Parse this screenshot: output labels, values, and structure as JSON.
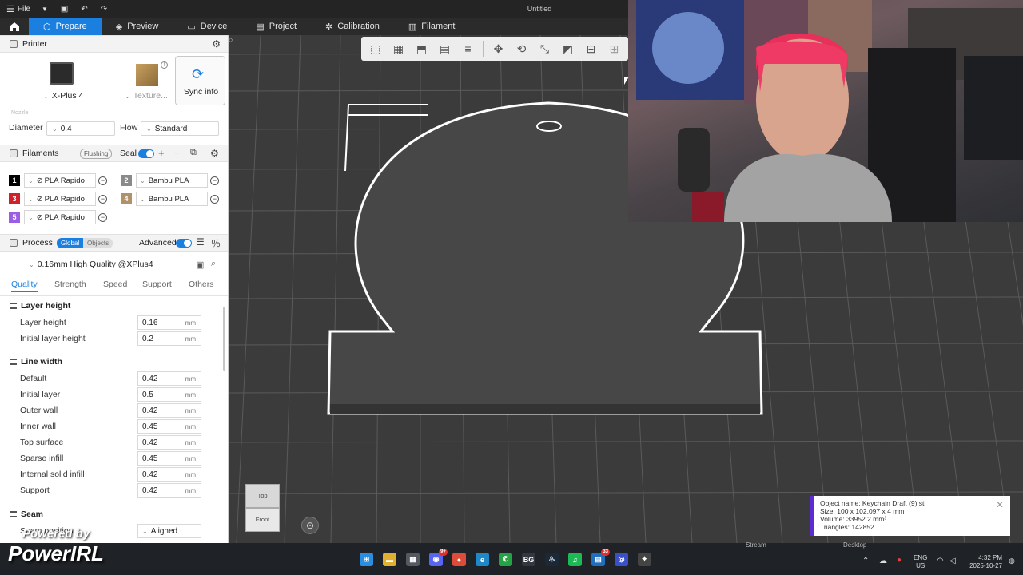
{
  "titlebar": {
    "file_label": "File",
    "title": "Untitled"
  },
  "tabs": [
    {
      "label": "Prepare",
      "icon": "cube-icon"
    },
    {
      "label": "Preview",
      "icon": "layers-icon"
    },
    {
      "label": "Device",
      "icon": "device-icon"
    },
    {
      "label": "Project",
      "icon": "project-icon"
    },
    {
      "label": "Calibration",
      "icon": "calibration-icon"
    },
    {
      "label": "Filament",
      "icon": "filament-icon"
    }
  ],
  "printer": {
    "section_title": "Printer",
    "model": "X-Plus 4",
    "plate": "Texture...",
    "sync_label": "Sync info",
    "nozzle_label": "Nozzle",
    "diameter_label": "Diameter",
    "diameter_value": "0.4",
    "flow_label": "Flow",
    "flow_value": "Standard"
  },
  "filaments": {
    "section_title": "Filaments",
    "flushing_label": "Flushing",
    "seal_label": "Seal",
    "items": [
      {
        "num": "1",
        "color": "#000000",
        "name": "PLA Rapido"
      },
      {
        "num": "2",
        "color": "#8a8a8a",
        "name": "Bambu PLA"
      },
      {
        "num": "3",
        "color": "#d0202a",
        "name": "PLA Rapido"
      },
      {
        "num": "4",
        "color": "#b0916a",
        "name": "Bambu PLA"
      },
      {
        "num": "5",
        "color": "#9b5de5",
        "name": "PLA Rapido"
      }
    ]
  },
  "process": {
    "section_title": "Process",
    "global_label": "Global",
    "objects_label": "Objects",
    "advanced_label": "Advanced",
    "profile": "0.16mm High Quality @XPlus4",
    "subtabs": [
      "Quality",
      "Strength",
      "Speed",
      "Support",
      "Others"
    ],
    "layer_height_group": "Layer height",
    "layer_height_rows": [
      {
        "label": "Layer height",
        "value": "0.16",
        "unit": "mm"
      },
      {
        "label": "Initial layer height",
        "value": "0.2",
        "unit": "mm"
      }
    ],
    "line_width_group": "Line width",
    "line_width_rows": [
      {
        "label": "Default",
        "value": "0.42",
        "unit": "mm"
      },
      {
        "label": "Initial layer",
        "value": "0.5",
        "unit": "mm"
      },
      {
        "label": "Outer wall",
        "value": "0.42",
        "unit": "mm"
      },
      {
        "label": "Inner wall",
        "value": "0.45",
        "unit": "mm"
      },
      {
        "label": "Top surface",
        "value": "0.42",
        "unit": "mm"
      },
      {
        "label": "Sparse infill",
        "value": "0.45",
        "unit": "mm"
      },
      {
        "label": "Internal solid infill",
        "value": "0.42",
        "unit": "mm"
      },
      {
        "label": "Support",
        "value": "0.42",
        "unit": "mm"
      }
    ],
    "seam_group": "Seam",
    "seam_position_label": "Seam position",
    "seam_position_value": "Aligned"
  },
  "viewcube": {
    "top": "Top",
    "front": "Front"
  },
  "object_info": {
    "name": "Object name: Keychain Draft (9).stl",
    "size": "Size: 100 x 102.097 x 4 mm",
    "volume": "Volume: 33952.2 mm³",
    "triangles": "Triangles: 142852"
  },
  "stream_labels": {
    "stream": "Stream",
    "desktop": "Desktop"
  },
  "watermark": {
    "powered_by": "Powered by",
    "brand": "PowerIRL"
  },
  "taskbar": {
    "lang1": "ENG",
    "lang2": "US",
    "time": "4:32 PM",
    "date": "2025-10-27",
    "icons": [
      {
        "name": "windows-start-icon",
        "color": "#2a8de0",
        "glyph": "⊞",
        "badge": ""
      },
      {
        "name": "file-explorer-icon",
        "color": "#e0b030",
        "glyph": "▬",
        "badge": ""
      },
      {
        "name": "store-icon",
        "color": "#555a60",
        "glyph": "▦",
        "badge": ""
      },
      {
        "name": "discord-icon",
        "color": "#5865f2",
        "glyph": "◉",
        "badge": "9+"
      },
      {
        "name": "chrome-icon",
        "color": "#dd4b39",
        "glyph": "●",
        "badge": ""
      },
      {
        "name": "edge-icon",
        "color": "#1e88c8",
        "glyph": "e",
        "badge": ""
      },
      {
        "name": "whatsapp-icon",
        "color": "#25a244",
        "glyph": "✆",
        "badge": ""
      },
      {
        "name": "bg-app-icon",
        "color": "#333840",
        "glyph": "BG",
        "badge": ""
      },
      {
        "name": "steam-icon",
        "color": "#1b2838",
        "glyph": "♨",
        "badge": ""
      },
      {
        "name": "spotify-icon",
        "color": "#1db954",
        "glyph": "♫",
        "badge": ""
      },
      {
        "name": "chat-icon",
        "color": "#1f6fbf",
        "glyph": "▤",
        "badge": "33"
      },
      {
        "name": "orca-slicer-icon",
        "color": "#3a50c8",
        "glyph": "◎",
        "badge": ""
      },
      {
        "name": "app-icon",
        "color": "#444",
        "glyph": "✦",
        "badge": ""
      }
    ]
  }
}
